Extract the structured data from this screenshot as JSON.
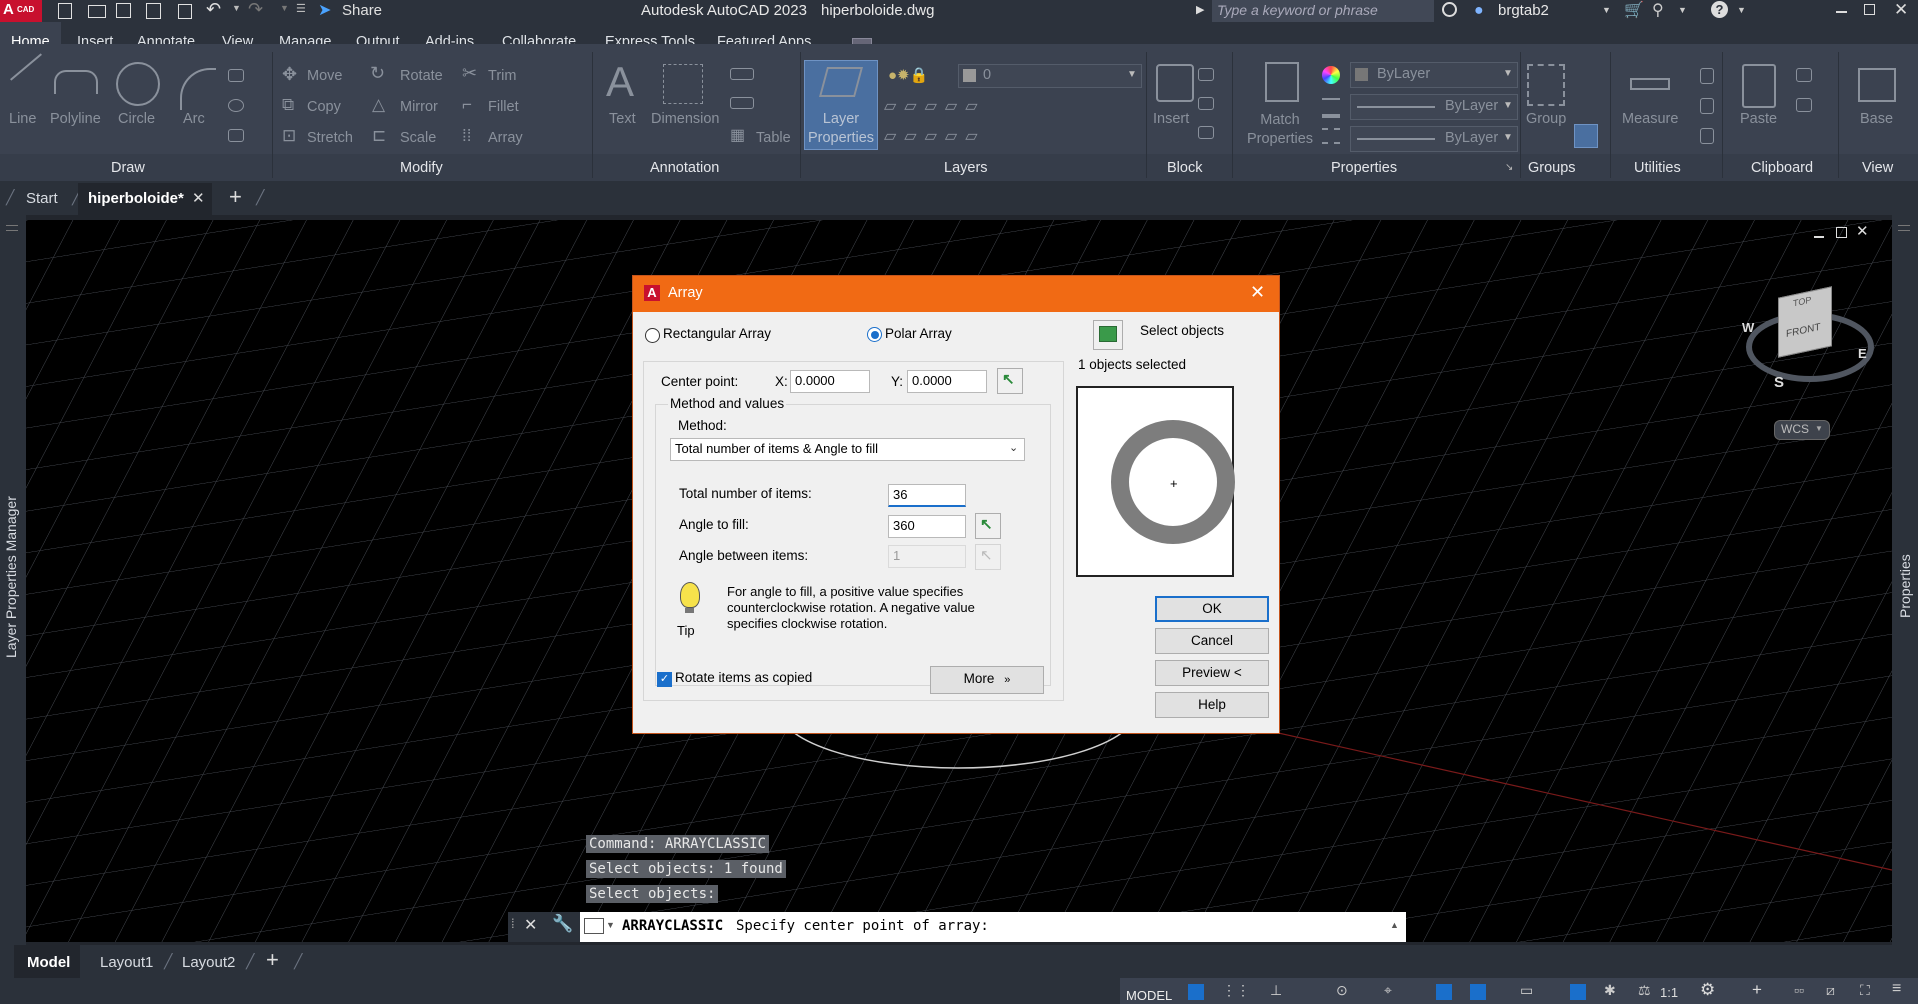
{
  "titlebar": {
    "app_badge": "CAD",
    "app_title": "Autodesk AutoCAD 2023",
    "file_name": "hiperboloide.dwg",
    "share_label": "Share",
    "search_placeholder": "Type a keyword or phrase",
    "user_name": "brgtab2"
  },
  "menu_tabs": [
    "Home",
    "Insert",
    "Annotate",
    "View",
    "Manage",
    "Output",
    "Add-ins",
    "Collaborate",
    "Express Tools",
    "Featured Apps"
  ],
  "ribbon": {
    "draw": {
      "title": "Draw",
      "tools": [
        "Line",
        "Polyline",
        "Circle",
        "Arc"
      ]
    },
    "modify": {
      "title": "Modify",
      "rows": [
        [
          "Move",
          "Rotate",
          "Trim"
        ],
        [
          "Copy",
          "Mirror",
          "Fillet"
        ],
        [
          "Stretch",
          "Scale",
          "Array"
        ]
      ]
    },
    "annotation": {
      "title": "Annotation",
      "tools": [
        "Text",
        "Dimension",
        "Table"
      ]
    },
    "layers": {
      "title": "Layers",
      "layer_props_label": "Layer\nProperties",
      "current_layer": "0"
    },
    "block": {
      "title": "Block",
      "insert_label": "Insert"
    },
    "properties": {
      "title": "Properties",
      "match_label": "Match\nProperties",
      "rows": [
        "ByLayer",
        "ByLayer",
        "ByLayer"
      ]
    },
    "groups": {
      "title": "Groups",
      "group_label": "Group"
    },
    "utilities": {
      "title": "Utilities",
      "measure_label": "Measure"
    },
    "clipboard": {
      "title": "Clipboard",
      "paste_label": "Paste"
    },
    "view": {
      "title": "View",
      "base_label": "Base"
    }
  },
  "doc_tabs": {
    "start": "Start",
    "active": "hiperboloide*"
  },
  "palettes": {
    "left": "Layer Properties Manager",
    "right": "Properties"
  },
  "viewcube": {
    "top": "TOP",
    "front": "FRONT",
    "w": "W",
    "e": "E",
    "s": "S",
    "wcs": "WCS"
  },
  "dialog": {
    "title": "Array",
    "rect_label": "Rectangular Array",
    "polar_label": "Polar Array",
    "select_objects_label": "Select objects",
    "objects_selected": "1 objects selected",
    "center_point_label": "Center point:",
    "x_label": "X:",
    "x_value": "0.0000",
    "y_label": "Y:",
    "y_value": "0.0000",
    "method_group_label": "Method and values",
    "method_label": "Method:",
    "method_value": "Total number of items & Angle to fill",
    "total_items_label": "Total number of items:",
    "total_items_value": "36",
    "angle_fill_label": "Angle to fill:",
    "angle_fill_value": "360",
    "angle_between_label": "Angle between items:",
    "angle_between_value": "1",
    "tip_label": "Tip",
    "tip_text": "For angle to fill, a positive value specifies counterclockwise rotation.  A negative value specifies clockwise rotation.",
    "rotate_label": "Rotate items as copied",
    "rotate_checked": true,
    "more_label": "More",
    "ok_label": "OK",
    "cancel_label": "Cancel",
    "preview_label": "Preview <",
    "help_label": "Help"
  },
  "command_history": [
    "Command: ARRAYCLASSIC",
    "Select objects: 1 found",
    "Select objects:"
  ],
  "command_line": {
    "command": "ARRAYCLASSIC",
    "prompt": "Specify center point of array:"
  },
  "layout_tabs": [
    "Model",
    "Layout1",
    "Layout2"
  ],
  "status": {
    "model_label": "MODEL",
    "scale": "1:1"
  },
  "colors": {
    "dialog_title": "#f16a14",
    "ribbon": "#3b4250",
    "selected_blue": "#1a6fcb"
  }
}
